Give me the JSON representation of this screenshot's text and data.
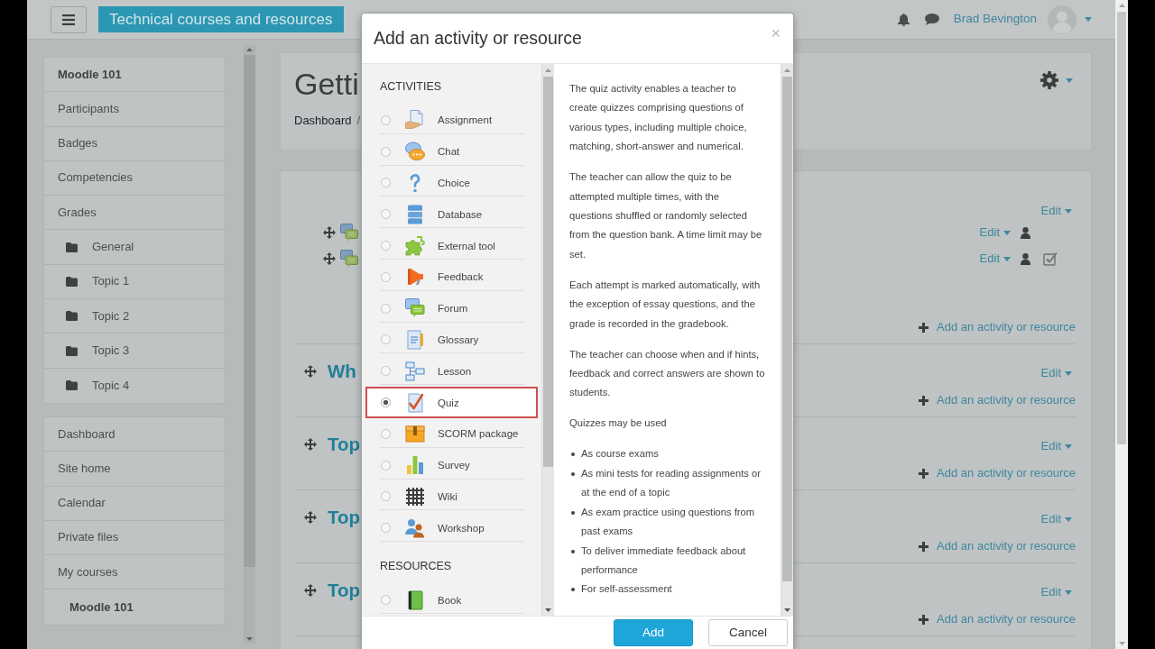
{
  "navbar": {
    "site_name": "Technical courses and resources",
    "user_name": "Brad Bevington"
  },
  "sidebar": [
    {
      "items": [
        {
          "label": "Moodle 101",
          "kind": "heading"
        },
        {
          "label": "Participants",
          "kind": "link"
        },
        {
          "label": "Badges",
          "kind": "link"
        },
        {
          "label": "Competencies",
          "kind": "link"
        },
        {
          "label": "Grades",
          "kind": "link"
        },
        {
          "label": "General",
          "kind": "section"
        },
        {
          "label": "Topic 1",
          "kind": "section"
        },
        {
          "label": "Topic 2",
          "kind": "section"
        },
        {
          "label": "Topic 3",
          "kind": "section"
        },
        {
          "label": "Topic 4",
          "kind": "section"
        }
      ]
    },
    {
      "items": [
        {
          "label": "Dashboard",
          "kind": "link"
        },
        {
          "label": "Site home",
          "kind": "link"
        },
        {
          "label": "Calendar",
          "kind": "link"
        },
        {
          "label": "Private files",
          "kind": "link"
        },
        {
          "label": "My courses",
          "kind": "link"
        },
        {
          "label": "Moodle 101",
          "kind": "child"
        }
      ]
    }
  ],
  "page_header": {
    "title": "Getti",
    "breadcrumb": [
      {
        "label": "Dashboard",
        "separator": "/"
      }
    ]
  },
  "sections": [
    {
      "edit_label": "Edit",
      "activities": [
        {
          "edit_label": "Edit",
          "completion": false
        },
        {
          "edit_label": "Edit",
          "completion": true
        }
      ],
      "add_label": "Add an activity or resource"
    },
    {
      "title": "Wh",
      "edit_label": "Edit",
      "add_label": "Add an activity or resource"
    },
    {
      "title": "Top",
      "edit_label": "Edit",
      "add_label": "Add an activity or resource"
    },
    {
      "title": "Top",
      "edit_label": "Edit",
      "add_label": "Add an activity or resource"
    },
    {
      "title": "Top",
      "edit_label": "Edit",
      "add_label": "Add an activity or resource"
    }
  ],
  "modal": {
    "title": "Add an activity or resource",
    "close_label": "×",
    "groups": [
      {
        "heading": "ACTIVITIES",
        "items": [
          {
            "label": "Assignment",
            "kind": "assignment",
            "selected": false
          },
          {
            "label": "Chat",
            "kind": "chat",
            "selected": false
          },
          {
            "label": "Choice",
            "kind": "choice",
            "selected": false
          },
          {
            "label": "Database",
            "kind": "database",
            "selected": false
          },
          {
            "label": "External tool",
            "kind": "external_tool",
            "selected": false
          },
          {
            "label": "Feedback",
            "kind": "feedback",
            "selected": false
          },
          {
            "label": "Forum",
            "kind": "forum",
            "selected": false
          },
          {
            "label": "Glossary",
            "kind": "glossary",
            "selected": false
          },
          {
            "label": "Lesson",
            "kind": "lesson",
            "selected": false
          },
          {
            "label": "Quiz",
            "kind": "quiz",
            "selected": true
          },
          {
            "label": "SCORM package",
            "kind": "scorm",
            "selected": false
          },
          {
            "label": "Survey",
            "kind": "survey",
            "selected": false
          },
          {
            "label": "Wiki",
            "kind": "wiki",
            "selected": false
          },
          {
            "label": "Workshop",
            "kind": "workshop",
            "selected": false
          }
        ]
      },
      {
        "heading": "RESOURCES",
        "items": [
          {
            "label": "Book",
            "kind": "book",
            "selected": false
          }
        ]
      }
    ],
    "help": {
      "paragraphs": [
        "The quiz activity enables a teacher to create quizzes comprising questions of various types, including multiple choice, matching, short-answer and numerical.",
        "The teacher can allow the quiz to be attempted multiple times, with the questions shuffled or randomly selected from the question bank. A time limit may be set.",
        "Each attempt is marked automatically, with the exception of essay questions, and the grade is recorded in the gradebook.",
        "The teacher can choose when and if hints, feedback and correct answers are shown to students.",
        "Quizzes may be used"
      ],
      "bullets": [
        "As course exams",
        "As mini tests for reading assignments or at the end of a topic",
        "As exam practice using questions from past exams",
        "To deliver immediate feedback about performance",
        "For self-assessment"
      ]
    },
    "buttons": [
      {
        "label": "Add",
        "kind": "primary"
      },
      {
        "label": "Cancel",
        "kind": "secondary"
      }
    ]
  }
}
